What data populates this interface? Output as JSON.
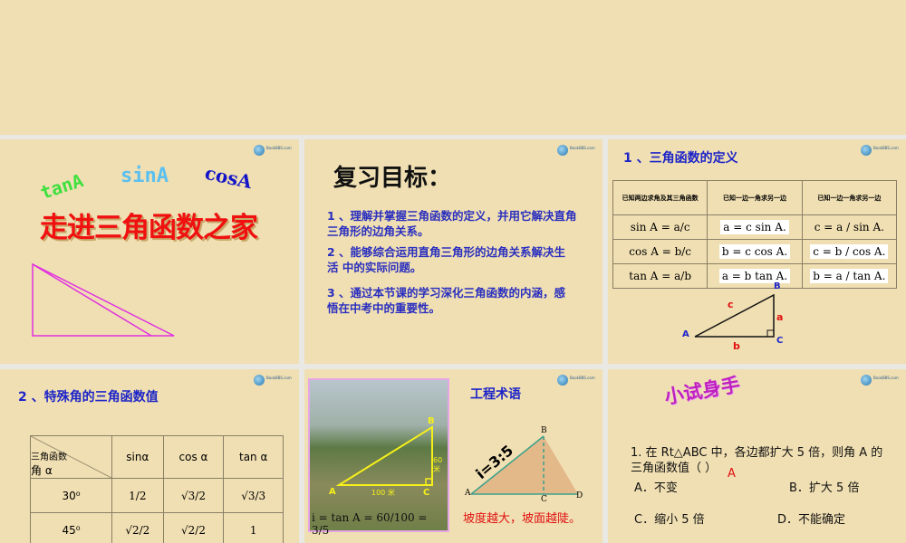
{
  "logo_text": "BookBBS.com",
  "slide1": {
    "tan": "tanA",
    "sin": "sinA",
    "cos": "cosA",
    "title": "走进三角函数之家"
  },
  "slide2": {
    "title": "复习目标：",
    "goals": [
      "1 、理解并掌握三角函数的定义，并用它解决直角  三角形的边角关系。",
      "2 、能够综合运用直角三角形的边角关系解决生活  中的实际问题。",
      "3 、通过本节课的学习深化三角函数的内涵，感悟在中考中的重要性。"
    ]
  },
  "slide3": {
    "title": "1 、三角函数的定义",
    "headers": [
      "已知两边求角及其三角函数",
      "已知一边一角求另一边",
      "已知一边一角求另一边"
    ],
    "rows": [
      [
        "sin A = a/c",
        "a = c sin A.",
        "c = a / sin A."
      ],
      [
        "cos A = b/c",
        "b = c cos A.",
        "c = b / cos A."
      ],
      [
        "tan A = a/b",
        "a = b tan A.",
        "b = a / tan A."
      ]
    ],
    "labels": {
      "A": "A",
      "B": "B",
      "C": "C",
      "a": "a",
      "b": "b",
      "c": "c"
    }
  },
  "slide4": {
    "title": "2 、特殊角的三角函数值",
    "corner_top": "三角函数",
    "corner_bottom": "角 α",
    "cols": [
      "sinα",
      "cos α",
      "tan α"
    ],
    "rows": [
      {
        "angle": "30⁰",
        "sin": "1/2",
        "cos": "√3/2",
        "tan": "√3/3"
      },
      {
        "angle": "45⁰",
        "sin": "√2/2",
        "cos": "√2/2",
        "tan": "1"
      }
    ]
  },
  "slide5": {
    "title": "工程术语",
    "photo_labels": {
      "A": "A",
      "B": "B",
      "C": "C",
      "base": "100 米",
      "height": "60 米"
    },
    "formula": "i = tan A = 60/100 = 3/5",
    "slope": "i=3:5",
    "tri_labels": {
      "A": "A",
      "B": "B",
      "C": "C",
      "D": "D"
    },
    "note": "坡度越大，坡面越陡。"
  },
  "slide6": {
    "title": "小试身手",
    "question": "1. 在 Rt△ABC 中，各边都扩大 5 倍，则角 A 的三角函数值（       ）",
    "answer": "A",
    "options": [
      "A．不变",
      "B．扩大 5 倍",
      "C．缩小 5 倍",
      "D．不能确定"
    ]
  }
}
